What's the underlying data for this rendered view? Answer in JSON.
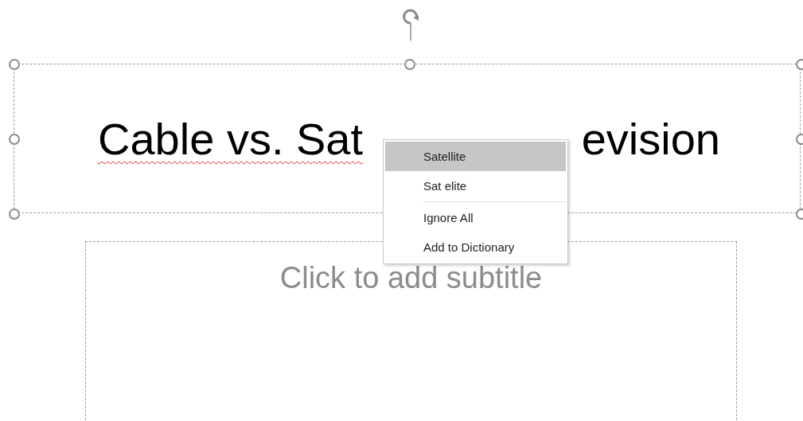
{
  "title_box": {
    "text_parts": [
      "Cable vs. Sat",
      "evision"
    ]
  },
  "subtitle_box": {
    "placeholder": "Click to add subtitle"
  },
  "context_menu": {
    "items": [
      {
        "kind": "suggestion",
        "label": "Satellite",
        "selected": true
      },
      {
        "kind": "suggestion",
        "label": "Sat elite",
        "selected": false
      },
      {
        "kind": "separator"
      },
      {
        "kind": "command",
        "label": "Ignore All",
        "selected": false
      },
      {
        "kind": "command",
        "label": "Add to Dictionary",
        "selected": false
      }
    ]
  }
}
